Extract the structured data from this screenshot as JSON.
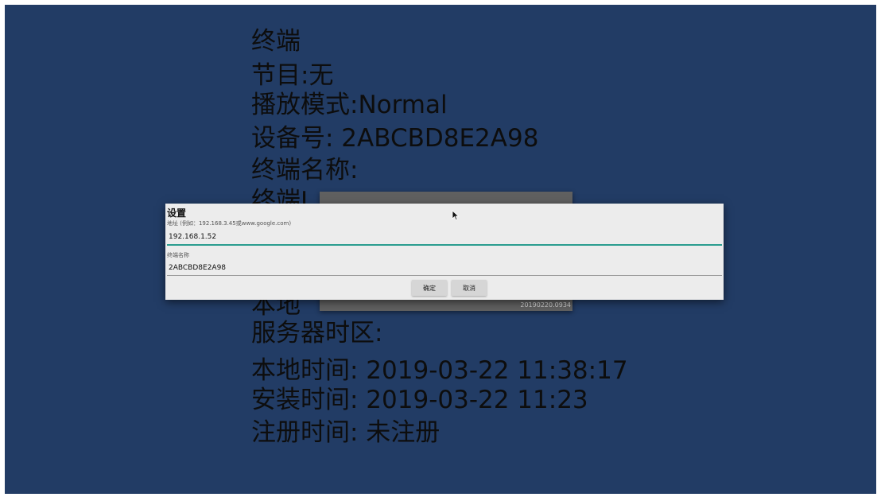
{
  "info": {
    "lines": [
      "终端",
      "节目:无",
      "播放模式:Normal",
      "设备号: 2ABCBD8E2A98",
      "终端名称:",
      "终端I",
      "",
      "",
      "本地",
      "服务器时区:",
      "本地时间: 2019-03-22 11:38:17",
      "安装时间: 2019-03-22 11:23",
      "注册时间: 未注册"
    ]
  },
  "background_panel": {
    "version_text": "20190220.0934"
  },
  "dialog": {
    "title": "设置",
    "address_label": "地址 (例如：192.168.3.45或www.google.com)",
    "address_value": "192.168.1.52",
    "name_label": "终端名称",
    "name_value": "2ABCBD8E2A98",
    "ok_label": "确定",
    "cancel_label": "取消"
  },
  "icons": {
    "cursor": "mouse-pointer-icon"
  },
  "colors": {
    "screen_background": "#223c65",
    "dialog_background": "#ececec",
    "active_underline": "#2a9d8f"
  }
}
